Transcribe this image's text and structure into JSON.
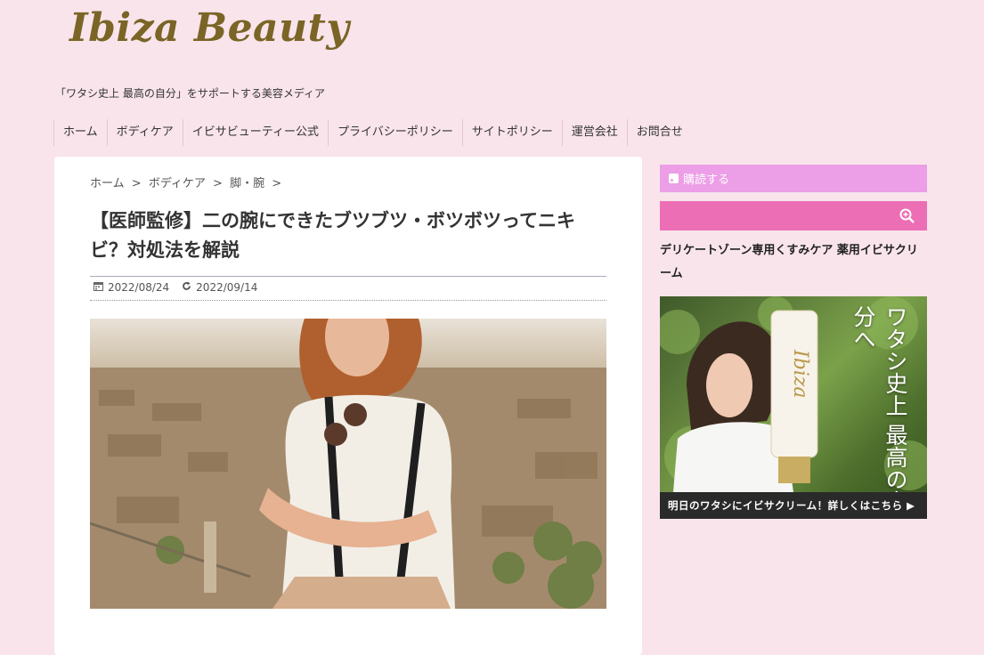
{
  "site": {
    "logo": "Ibiza Beauty",
    "tagline": "「ワタシ史上 最高の自分」をサポートする美容メディア"
  },
  "nav": {
    "items": [
      {
        "label": "ホーム"
      },
      {
        "label": "ボディケア"
      },
      {
        "label": "イビサビューティー公式"
      },
      {
        "label": "プライバシーポリシー"
      },
      {
        "label": "サイトポリシー"
      },
      {
        "label": "運営会社"
      },
      {
        "label": "お問合せ"
      }
    ]
  },
  "breadcrumb": {
    "home": "ホーム",
    "category": "ボディケア",
    "subcategory": "脚・腕",
    "sep": ">"
  },
  "article": {
    "title": "【医師監修】二の腕にできたブツブツ・ボツボツってニキビ？対処法を解説",
    "published": "2022/08/24",
    "updated": "2022/09/14"
  },
  "sidebar": {
    "subscribe_label": "購読する",
    "heading": "デリケートゾーン専用くすみケア 薬用イビサクリーム",
    "banner": {
      "product_logo": "Ibiza",
      "copy": "ワタシ史上 最高の自分へ",
      "cta": "明日のワタシにイビサクリーム！詳しくはこちら ▶"
    }
  },
  "colors": {
    "background": "#f9e4ec",
    "logo": "#7a6526",
    "subscribe": "#ec9ee6",
    "search": "#ec6eb5"
  }
}
